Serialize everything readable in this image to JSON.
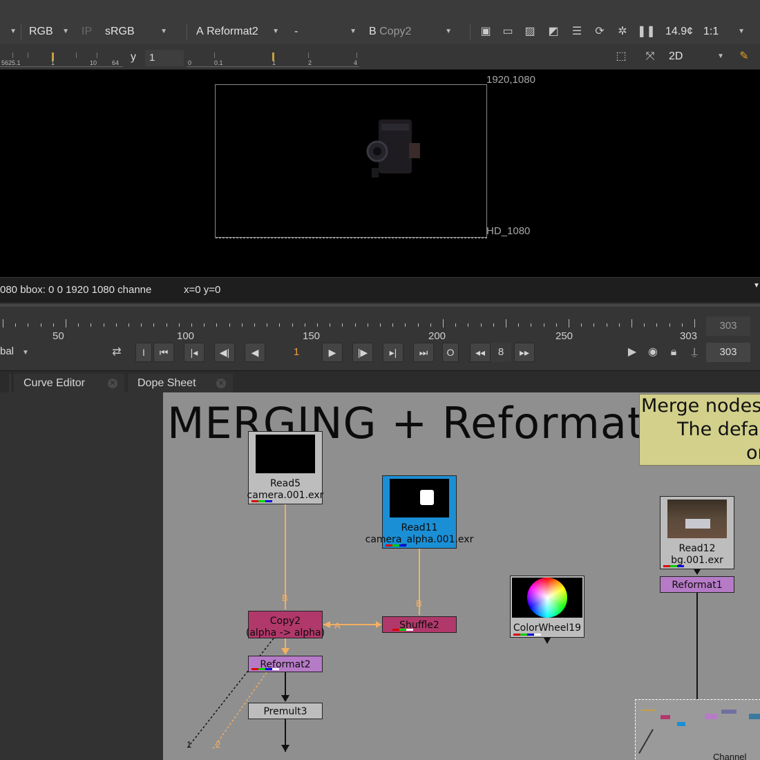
{
  "viewer_toolbar": {
    "channels": "RGB",
    "ip": "IP",
    "colorspace": "sRGB",
    "input_a_label": "A",
    "input_a": "Reformat2",
    "operation": "-",
    "input_b_label": "B",
    "input_b": "Copy2",
    "zoom": "14.9¢",
    "scale": "1:1",
    "gamma_label": "y",
    "gamma_value": "1",
    "view_mode": "2D",
    "gain_ruler": [
      "5625.1",
      "1",
      "10",
      "64"
    ],
    "gamma_ruler": [
      "0",
      "0.1",
      "1",
      "2",
      "4"
    ]
  },
  "viewer": {
    "format_size": "1920,1080",
    "format_name": "HD_1080",
    "info": "080  bbox: 0 0 1920 1080 channe",
    "coords": "x=0 y=0"
  },
  "timeline": {
    "labels": [
      "50",
      "100",
      "150",
      "200",
      "250",
      "303"
    ],
    "end_frame_top": "303",
    "end_frame_bottom": "303",
    "range_mode": "bal",
    "current_frame": "1",
    "increment": "8",
    "in_point_label": "I",
    "out_point_label": "O"
  },
  "tabs": {
    "curve_editor": "Curve Editor",
    "dope_sheet": "Dope Sheet",
    "close": "✕"
  },
  "nodegraph": {
    "title": "MERGING + Reformat",
    "sticky_lines": [
      "Merge nodes",
      "The defa",
      "or"
    ],
    "read5": {
      "name": "Read5",
      "file": "camera.001.exr"
    },
    "read11": {
      "name": "Read11",
      "file": "camera_alpha.001.exr"
    },
    "read12": {
      "name": "Read12",
      "file": "bg.001.exr"
    },
    "copy2": {
      "name": "Copy2",
      "sub": "(alpha -> alpha)"
    },
    "shuffle2": {
      "name": "Shuffle2"
    },
    "reformat2": {
      "name": "Reformat2"
    },
    "reformat1": {
      "name": "Reformat1"
    },
    "premult3": {
      "name": "Premult3"
    },
    "colorwheel": {
      "name": "ColorWheel19"
    },
    "pipe_labels": {
      "b": "B",
      "a": "A",
      "one": "1",
      "two": "2"
    },
    "footer_text": "Channel"
  },
  "colors": {
    "read_node": "#bdbdbd",
    "read11_node": "#1b8fd6",
    "copy_node": "#b1386b",
    "reformat_node": "#b67bc6",
    "pipe_orange": "#f3b061",
    "sticky": "#d2d08a"
  }
}
